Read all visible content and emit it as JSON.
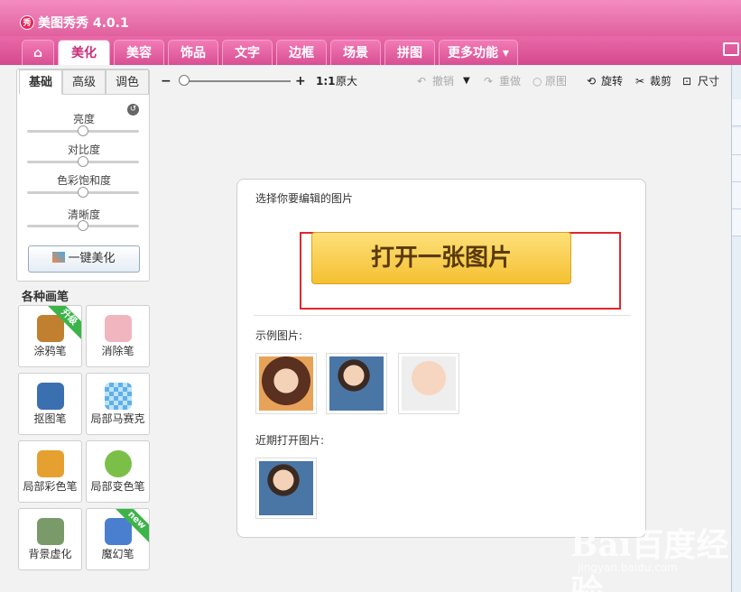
{
  "app": {
    "title": "美图秀秀 4.0.1",
    "logo_text": "秀"
  },
  "tabs": [
    {
      "label": "⌂"
    },
    {
      "label": "美化"
    },
    {
      "label": "美容"
    },
    {
      "label": "饰品"
    },
    {
      "label": "文字"
    },
    {
      "label": "边框"
    },
    {
      "label": "场景"
    },
    {
      "label": "拼图"
    },
    {
      "label": "更多功能 ▾"
    }
  ],
  "subtabs": [
    "基础",
    "高级",
    "调色"
  ],
  "sliders": [
    {
      "label": "亮度",
      "value": 0.5
    },
    {
      "label": "对比度",
      "value": 0.5
    },
    {
      "label": "色彩饱和度",
      "value": 0.5
    },
    {
      "label": "清晰度",
      "value": 0.5
    }
  ],
  "one_key_label": "一键美化",
  "brush_section_title": "各种画笔",
  "brushes": [
    {
      "label": "涂鸦笔",
      "badge": "升级",
      "color": "#c08030"
    },
    {
      "label": "消除笔",
      "badge": "",
      "color": "#f1b5c0"
    },
    {
      "label": "抠图笔",
      "badge": "",
      "color": "#3a6fb0"
    },
    {
      "label": "局部马赛克",
      "badge": "",
      "color": "#5fb0e8"
    },
    {
      "label": "局部彩色笔",
      "badge": "",
      "color": "#e6a030"
    },
    {
      "label": "局部变色笔",
      "badge": "",
      "color": "#7bbf48"
    },
    {
      "label": "背景虚化",
      "badge": "",
      "color": "#7a9a6a"
    },
    {
      "label": "魔幻笔",
      "badge": "new",
      "color": "#4a7fd0"
    }
  ],
  "toolbar": {
    "zoom_out": "−",
    "zoom_in": "+",
    "ratio": "1:1",
    "original_size": "原大",
    "undo": "撤销",
    "redo": "重做",
    "original": "原图",
    "rotate": "旋转",
    "crop": "裁剪",
    "size": "尺寸"
  },
  "open_panel": {
    "choose_title": "选择你要编辑的图片",
    "open_button": "打开一张图片",
    "sample_label": "示例图片:",
    "recent_label": "近期打开图片:"
  },
  "watermark": {
    "main": "Bai百度经验",
    "sub": "jingyan.baidu.com"
  }
}
